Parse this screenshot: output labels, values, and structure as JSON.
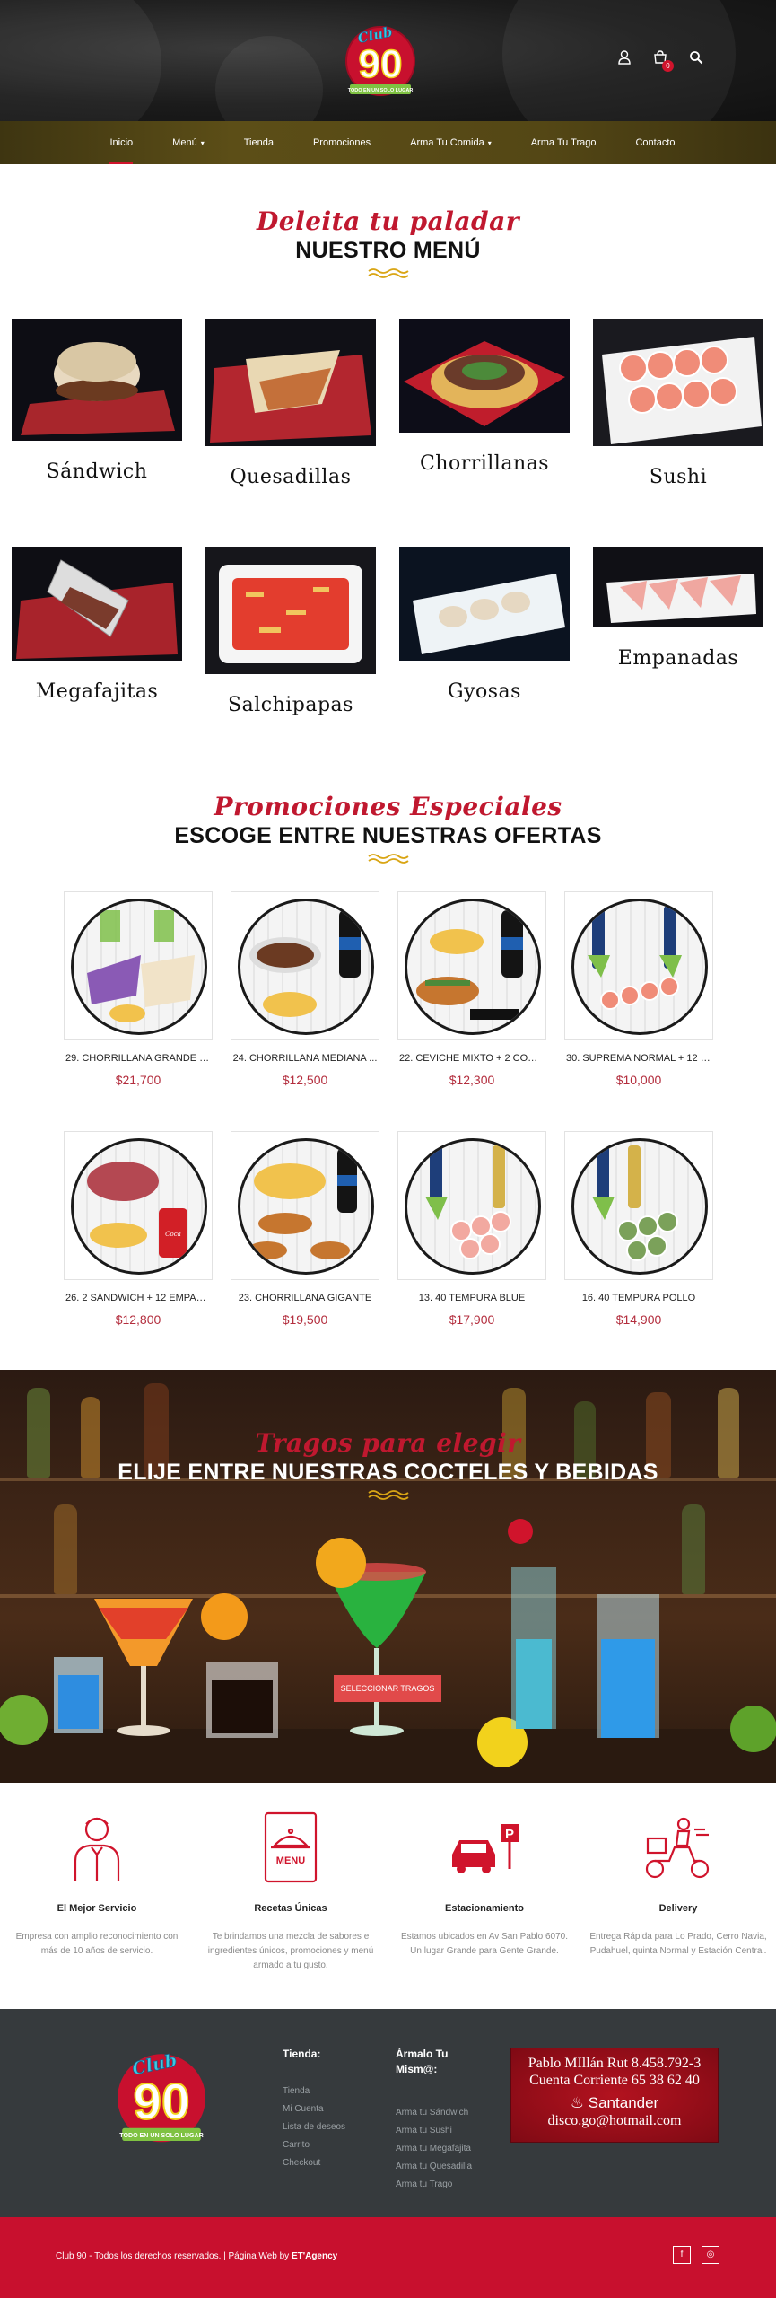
{
  "header": {
    "logo_text": "Club 90",
    "logo_tagline": "TODO EN UN SOLO LUGAR",
    "cart_count": "0",
    "icons": [
      "user-icon",
      "cart-icon",
      "search-icon"
    ]
  },
  "nav": {
    "items": [
      {
        "label": "Inicio",
        "active": true
      },
      {
        "label": "Menú",
        "dropdown": true
      },
      {
        "label": "Tienda"
      },
      {
        "label": "Promociones"
      },
      {
        "label": "Arma Tu Comida",
        "dropdown": true
      },
      {
        "label": "Arma Tu Trago"
      },
      {
        "label": "Contacto"
      }
    ]
  },
  "menu_section": {
    "script": "Deleita tu paladar",
    "title": "NUESTRO MENÚ",
    "items": [
      {
        "name": "Sándwich"
      },
      {
        "name": "Quesadillas"
      },
      {
        "name": "Chorrillanas"
      },
      {
        "name": "Sushi"
      },
      {
        "name": "Megafajitas"
      },
      {
        "name": "Salchipapas"
      },
      {
        "name": "Gyosas"
      },
      {
        "name": "Empanadas"
      }
    ]
  },
  "promo_section": {
    "script": "Promociones Especiales",
    "title": "ESCOGE ENTRE NUESTRAS OFERTAS",
    "products": [
      {
        "name": "29. CHORRILLANA GRANDE + ...",
        "price": "$21,700"
      },
      {
        "name": "24. CHORRILLANA MEDIANA ...",
        "price": "$12,500"
      },
      {
        "name": "22. CEVICHE MIXTO + 2 CORO...",
        "price": "$12,300"
      },
      {
        "name": "30. SUPREMA NORMAL + 12 E...",
        "price": "$10,000"
      },
      {
        "name": "26. 2 SÁNDWICH + 12 EMPAN...",
        "price": "$12,800"
      },
      {
        "name": "23. CHORRILLANA GIGANTE",
        "price": "$19,500"
      },
      {
        "name": "13. 40 TEMPURA BLUE",
        "price": "$17,900"
      },
      {
        "name": "16. 40 TEMPURA POLLO",
        "price": "$14,900"
      }
    ]
  },
  "drinks_section": {
    "script": "Tragos para elegir",
    "title": "ELIJE ENTRE NUESTRAS COCTELES Y BEBIDAS",
    "button": "SELECCIONAR TRAGOS"
  },
  "features": [
    {
      "icon": "waiter-icon",
      "title": "El Mejor Servicio",
      "desc": "Empresa con amplio reconocimiento con más de 10 años de servicio."
    },
    {
      "icon": "menu-book-icon",
      "title": "Recetas Únicas",
      "desc": "Te brindamos una mezcla de sabores e ingredientes únicos, promociones y menú armado a tu gusto."
    },
    {
      "icon": "parking-car-icon",
      "title": "Estacionamiento",
      "desc": "Estamos ubicados en Av San Pablo 6070. Un lugar Grande  para Gente Grande."
    },
    {
      "icon": "delivery-scooter-icon",
      "title": "Delivery",
      "desc": "Entrega Rápida para Lo Prado, Cerro Navia, Pudahuel, quinta Normal y Estación Central."
    }
  ],
  "footer": {
    "tienda_title": "Tienda:",
    "tienda_links": [
      "Tienda",
      "Mi Cuenta",
      "Lista de deseos",
      "Carrito",
      "Checkout"
    ],
    "armalo_title_1": "Ármalo Tu",
    "armalo_title_2": "Mism@:",
    "armalo_links": [
      "Arma tu Sándwich",
      "Arma tu Sushi",
      "Arma tu Megafajita",
      "Arma tu Quesadilla",
      "Arma tu Trago"
    ],
    "bank": {
      "line1": "Pablo MIllán   Rut 8.458.792-3",
      "line2": "Cuenta Corriente  65 38 62 40",
      "line3": "Santander",
      "line4": "disco.go@hotmail.com"
    },
    "copyright": "Club 90 - Todos los derechos reservados.   |  Página Web by ",
    "agency": "ET'Agency",
    "social": [
      "facebook-icon",
      "instagram-icon"
    ]
  },
  "colors": {
    "accent": "#c8102e",
    "price": "#b32d3d",
    "nav_bg": "#544715",
    "footer_bg": "#363a3d",
    "wave": "#d9a514"
  }
}
